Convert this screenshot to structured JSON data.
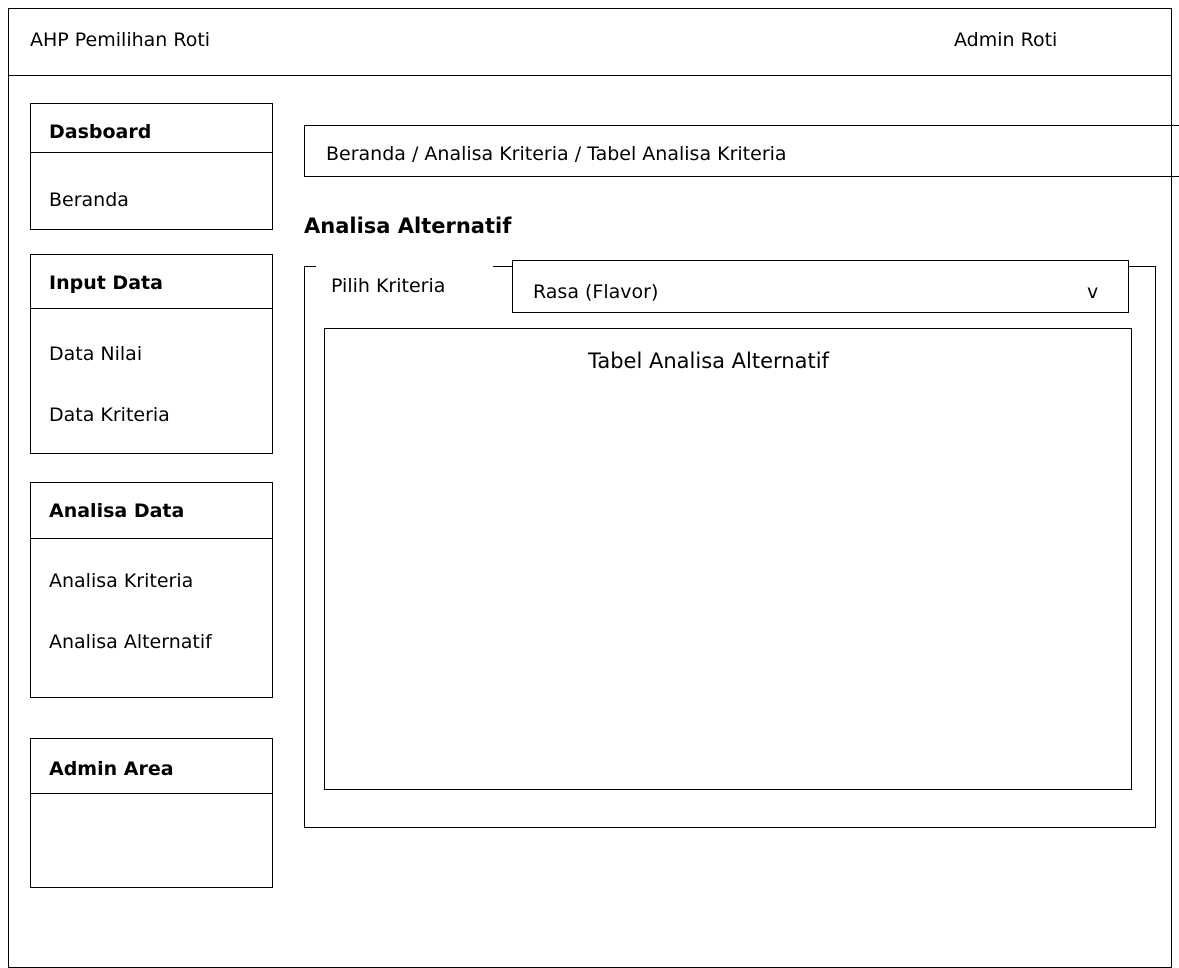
{
  "header": {
    "app_title": "AHP Pemilihan Roti",
    "user_name": "Admin Roti"
  },
  "sidebar": {
    "sections": [
      {
        "title": "Dasboard",
        "items": [
          "Beranda"
        ]
      },
      {
        "title": "Input Data",
        "items": [
          "Data Nilai",
          "Data Kriteria"
        ]
      },
      {
        "title": "Analisa Data",
        "items": [
          "Analisa Kriteria",
          "Analisa Alternatif"
        ]
      },
      {
        "title": "Admin Area",
        "items": []
      }
    ]
  },
  "main": {
    "breadcrumb": "Beranda / Analisa Kriteria / Tabel Analisa Kriteria",
    "page_title": "Analisa Alternatif",
    "filter": {
      "label": "Pilih Kriteria",
      "selected": "Rasa (Flavor)",
      "arrow": "v"
    },
    "table_title": "Tabel Analisa Alternatif"
  }
}
